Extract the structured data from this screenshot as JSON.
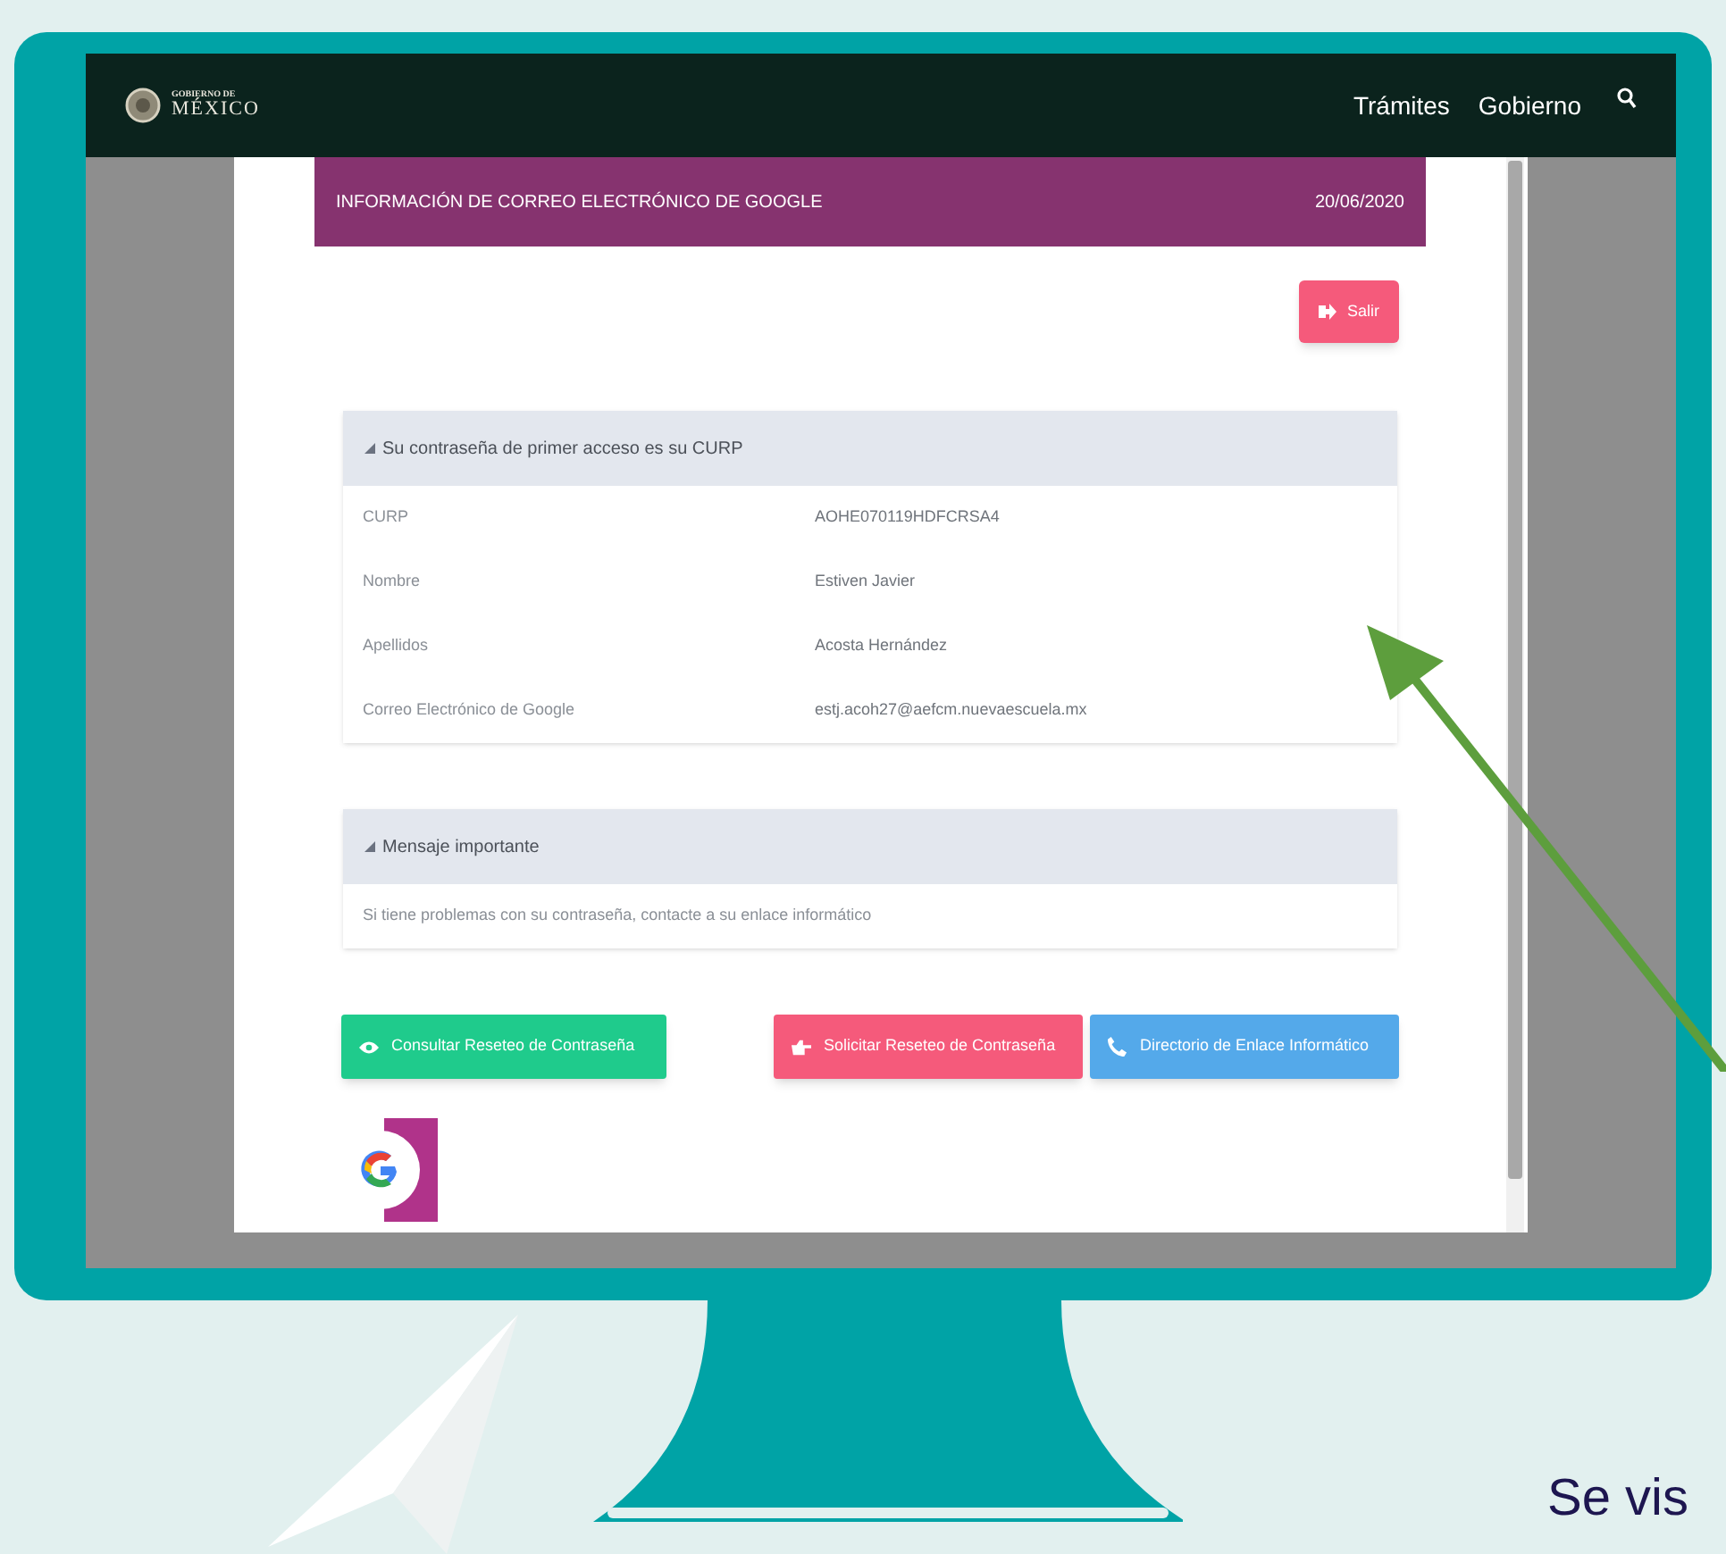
{
  "nav": {
    "logo_small": "GOBIERNO DE",
    "logo_large": "MÉXICO",
    "links": [
      "Trámites",
      "Gobierno"
    ]
  },
  "modal": {
    "title": "INFORMACIÓN DE CORREO ELECTRÓNICO DE GOOGLE",
    "date": "20/06/2020",
    "exit_button": "Salir",
    "sections": [
      {
        "kind": "table",
        "title": "Su contraseña de primer acceso es su CURP",
        "rows": [
          {
            "label": "CURP",
            "value": "AOHE070119HDFCRSA4"
          },
          {
            "label": "Nombre",
            "value": "Estiven Javier"
          },
          {
            "label": "Apellidos",
            "value": "Acosta Hernández"
          },
          {
            "label": "Correo Electrónico de Google",
            "value": "estj.acoh27@aefcm.nuevaescuela.mx"
          }
        ]
      },
      {
        "kind": "message",
        "title": "Mensaje importante",
        "text": "Si tiene problemas con su contraseña, contacte a su enlace informático"
      }
    ],
    "buttons": [
      {
        "kind": "eye",
        "label": "Consultar Reseteo de Contraseña",
        "color": "#1fcb8c"
      },
      {
        "kind": "hand",
        "label": "Solicitar Reseteo de Contraseña",
        "color": "#f55a7b"
      },
      {
        "kind": "phone",
        "label": "Directorio de Enlace Informático",
        "color": "#54a9ea"
      }
    ]
  },
  "caption": "Se vis"
}
